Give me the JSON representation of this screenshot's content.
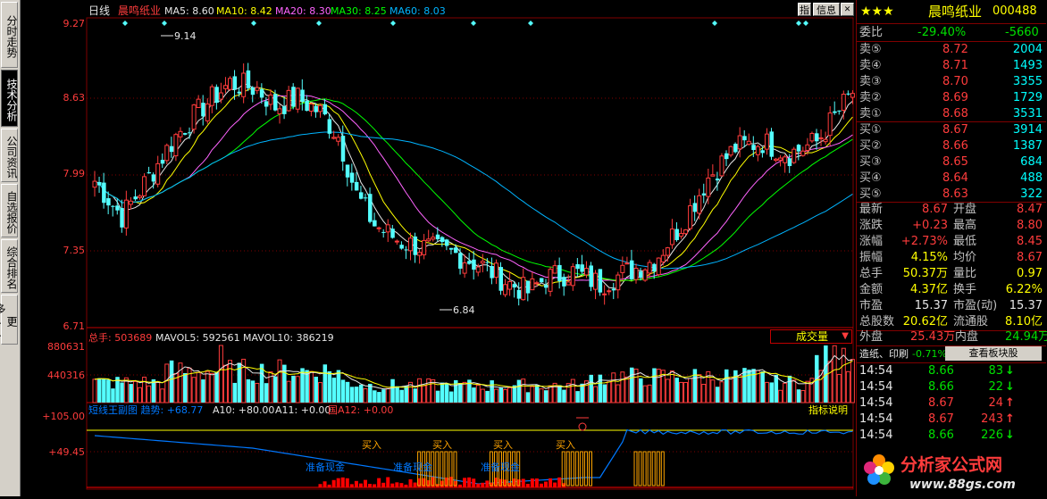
{
  "stock": {
    "name": "晨鸣纸业",
    "code": "000488",
    "stars": "★★★"
  },
  "toolbar": {
    "btn_indicator": "指",
    "btn_info": "信息"
  },
  "left_tabs": [
    {
      "label": "分时走势",
      "active": false
    },
    {
      "label": "技术分析",
      "active": true
    },
    {
      "label": "公司资讯",
      "active": false
    },
    {
      "label": "自选报价",
      "active": false
    },
    {
      "label": "综合排名",
      "active": false
    },
    {
      "label": "更多..",
      "active": false
    }
  ],
  "main_chart": {
    "period": "日线",
    "name": "晨鸣纸业",
    "ma_labels": [
      {
        "text": "MA5: 8.60",
        "color": "#e6e6e6"
      },
      {
        "text": "MA10: 8.42",
        "color": "#ffff00"
      },
      {
        "text": "MA20: 8.30",
        "color": "#ff64ff"
      },
      {
        "text": "MA30: 8.25",
        "color": "#00ff00"
      },
      {
        "text": "MA60: 8.03",
        "color": "#00b4ff"
      }
    ],
    "y_ticks": [
      "9.27",
      "8.63",
      "7.99",
      "7.35",
      "6.71"
    ],
    "y_values": [
      9.27,
      8.63,
      7.99,
      7.35,
      6.71
    ],
    "high_label": "9.14",
    "low_label": "6.84"
  },
  "volume_chart": {
    "label_total": "总手: 503689",
    "label_mavol5": "MAVOL5: 592561",
    "label_mavol10": "MAVOL10: 386219",
    "y_ticks": [
      "880631",
      "440316"
    ],
    "selector": "成交量",
    "selector_arrow": "▼"
  },
  "indicator_chart": {
    "title": "短线王副图 趋势: +68.77",
    "a10": "A10: +80.00",
    "a11": "A11: +0.00",
    "a12": "国A12: +0.00",
    "y_ticks": [
      "+105.00",
      "+49.45"
    ],
    "help": "指标说明",
    "buy_label": "买入",
    "prep_label": "准备现金"
  },
  "quote": {
    "weibi": {
      "label": "委比",
      "pct": "-29.40%",
      "diff": "-5660"
    },
    "sell": [
      {
        "label": "卖⑤",
        "price": "8.72",
        "vol": "2004"
      },
      {
        "label": "卖④",
        "price": "8.71",
        "vol": "1493"
      },
      {
        "label": "卖③",
        "price": "8.70",
        "vol": "3355"
      },
      {
        "label": "卖②",
        "price": "8.69",
        "vol": "1729"
      },
      {
        "label": "卖①",
        "price": "8.68",
        "vol": "3531"
      }
    ],
    "buy": [
      {
        "label": "买①",
        "price": "8.67",
        "vol": "3914"
      },
      {
        "label": "买②",
        "price": "8.66",
        "vol": "1387"
      },
      {
        "label": "买③",
        "price": "8.65",
        "vol": "684"
      },
      {
        "label": "买④",
        "price": "8.64",
        "vol": "488"
      },
      {
        "label": "买⑤",
        "price": "8.63",
        "vol": "322"
      }
    ],
    "stats": [
      {
        "l1": "最新",
        "v1": "8.67",
        "c1": "red",
        "l2": "开盘",
        "v2": "8.47",
        "c2": "red"
      },
      {
        "l1": "涨跌",
        "v1": "+0.23",
        "c1": "red",
        "l2": "最高",
        "v2": "8.80",
        "c2": "red"
      },
      {
        "l1": "涨幅",
        "v1": "+2.73%",
        "c1": "red",
        "l2": "最低",
        "v2": "8.45",
        "c2": "red"
      },
      {
        "l1": "振幅",
        "v1": "4.15%",
        "c1": "yellow",
        "l2": "均价",
        "v2": "8.67",
        "c2": "red"
      },
      {
        "l1": "总手",
        "v1": "50.37万",
        "c1": "yellow",
        "l2": "量比",
        "v2": "0.97",
        "c2": "yellow"
      },
      {
        "l1": "金额",
        "v1": "4.37亿",
        "c1": "yellow",
        "l2": "换手",
        "v2": "6.22%",
        "c2": "yellow"
      },
      {
        "l1": "市盈",
        "v1": "15.37",
        "c1": "white",
        "l2": "市盈(动)",
        "v2": "15.37",
        "c2": "white"
      },
      {
        "l1": "总股数",
        "v1": "20.62亿",
        "c1": "yellow",
        "l2": "流通股",
        "v2": "8.10亿",
        "c2": "yellow"
      }
    ],
    "waipan": {
      "l1": "外盘",
      "v1": "25.43万",
      "l2": "内盘",
      "v2": "24.94万"
    },
    "sector": {
      "name": "造纸、印刷",
      "pct": "-0.71%",
      "button": "查看板块股"
    },
    "ticks": [
      {
        "time": "14:54",
        "price": "8.66",
        "vol": "83",
        "dir": "down"
      },
      {
        "time": "14:54",
        "price": "8.66",
        "vol": "22",
        "dir": "down"
      },
      {
        "time": "14:54",
        "price": "8.67",
        "vol": "24",
        "dir": "up"
      },
      {
        "time": "14:54",
        "price": "8.67",
        "vol": "243",
        "dir": "up"
      },
      {
        "time": "14:54",
        "price": "8.66",
        "vol": "226",
        "dir": "down"
      }
    ]
  },
  "watermark": {
    "text": "分析家公式网",
    "url": "www.88gs.com"
  },
  "colors": {
    "up": "#ff3c3c",
    "down": "#54ffff",
    "border": "#800000",
    "bg": "#000000"
  }
}
